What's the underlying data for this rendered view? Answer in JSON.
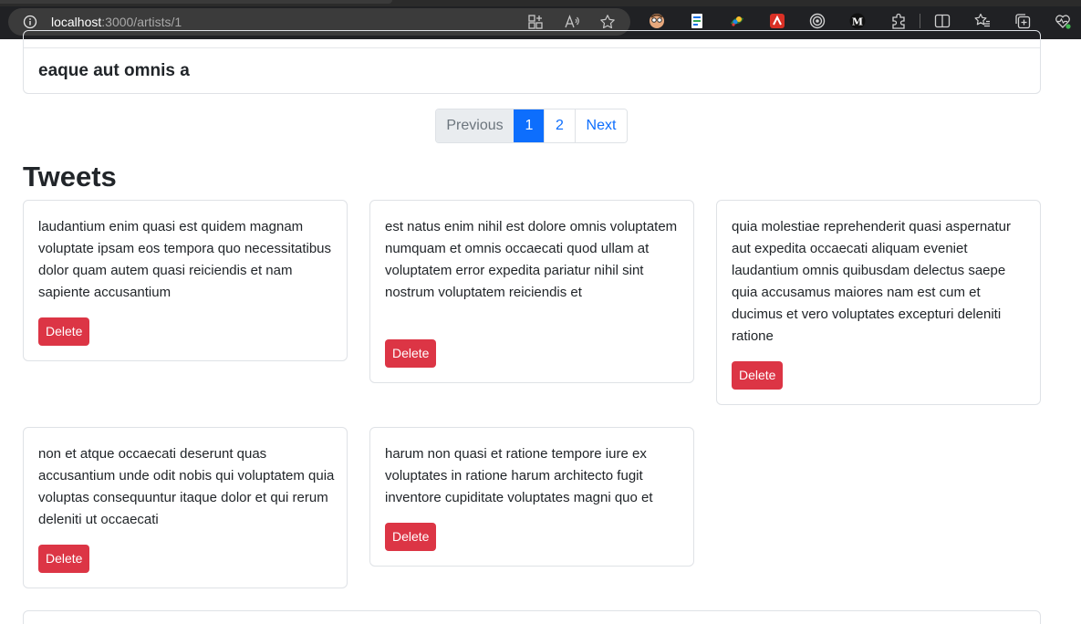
{
  "browser": {
    "url_host": "localhost",
    "url_path": ":3000/artists/1",
    "icons": [
      "info-icon",
      "app-available-icon",
      "read-aloud-icon",
      "favorite-star-icon",
      "extension-face-icon",
      "extension-doc-icon",
      "extension-paint-icon",
      "extension-red-icon",
      "extension-target-icon",
      "extension-m-icon",
      "extensions-puzzle-icon",
      "split-screen-icon",
      "favorites-icon",
      "collections-icon",
      "browser-health-icon"
    ]
  },
  "album": {
    "title": "eaque aut omnis a"
  },
  "pagination": {
    "previous": "Previous",
    "pages": [
      "1",
      "2"
    ],
    "active_page": "1",
    "next": "Next"
  },
  "tweets_section": {
    "title": "Tweets",
    "tweets": [
      {
        "text": "laudantium enim quasi est quidem magnam voluptate ipsam eos tempora quo necessitatibus dolor quam autem quasi reiciendis et nam sapiente accusantium",
        "delete_label": "Delete"
      },
      {
        "text": "est natus enim nihil est dolore omnis voluptatem numquam et omnis occaecati quod ullam at voluptatem error expedita pariatur nihil sint nostrum voluptatem reiciendis et",
        "delete_label": "Delete"
      },
      {
        "text": "quia molestiae reprehenderit quasi aspernatur aut expedita occaecati aliquam eveniet laudantium omnis quibusdam delectus saepe quia accusamus maiores nam est cum et ducimus et vero voluptates excepturi deleniti ratione",
        "delete_label": "Delete"
      },
      {
        "text": "non et atque occaecati deserunt quas accusantium unde odit nobis qui voluptatem quia voluptas consequuntur itaque dolor et qui rerum deleniti ut occaecati",
        "delete_label": "Delete"
      },
      {
        "text": "harum non quasi et ratione tempore iure ex voluptates in ratione harum architecto fugit inventore cupiditate voluptates magni quo et",
        "delete_label": "Delete"
      }
    ]
  },
  "colors": {
    "primary": "#0d6efd",
    "danger": "#dc3545",
    "border": "#dee2e6"
  }
}
